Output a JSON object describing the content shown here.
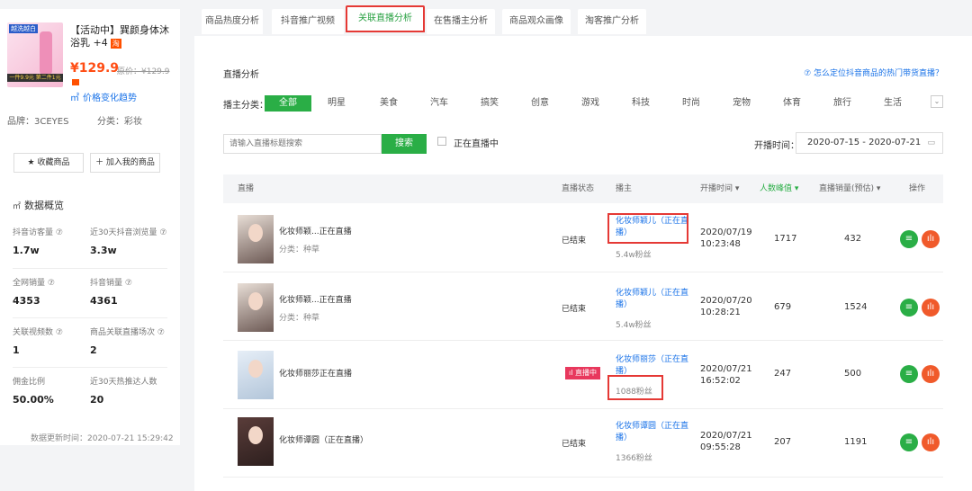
{
  "product": {
    "image_tag": "越洗越白",
    "image_bar": "一件9.9元 第二件1元",
    "title": "【活动中】巽颜身体沐浴乳 +4",
    "tb_badge": "淘",
    "price": "¥129.9",
    "original_price": "原价：¥129.9",
    "trend_link": "价格变化趋势",
    "brand": "品牌：3CEYES",
    "category": "分类：彩妆",
    "fav_button": "★ 收藏商品",
    "add_button": "＋ 加入我的商品"
  },
  "overview": {
    "title": "数据概览",
    "stats": [
      {
        "label": "抖音访客量 ⑦",
        "value": "1.7w"
      },
      {
        "label": "近30天抖音浏览量 ⑦",
        "value": "3.3w"
      },
      {
        "label": "全网销量 ⑦",
        "value": "4353"
      },
      {
        "label": "抖音销量 ⑦",
        "value": "4361"
      },
      {
        "label": "关联视频数 ⑦",
        "value": "1"
      },
      {
        "label": "商品关联直播场次 ⑦",
        "value": "2"
      },
      {
        "label": "佣金比例",
        "value": "50.00%"
      },
      {
        "label": "近30天热推达人数",
        "value": "20"
      }
    ],
    "updated": "数据更新时间：2020-07-21 15:29:42"
  },
  "tabs": [
    "商品热度分析",
    "抖音推广视频",
    "关联直播分析",
    "在售播主分析",
    "商品观众画像",
    "淘客推广分析"
  ],
  "active_tab": 2,
  "section": {
    "title": "直播分析",
    "help": "⑦ 怎么定位抖音商品的热门带货直播？"
  },
  "categories": {
    "label": "播主分类：",
    "items": [
      "全部",
      "明星",
      "美食",
      "汽车",
      "搞笑",
      "创意",
      "游戏",
      "科技",
      "时尚",
      "宠物",
      "体育",
      "旅行",
      "生活"
    ]
  },
  "search": {
    "placeholder": "请输入直播标题搜索",
    "button": "搜索",
    "live_only": "正在直播中",
    "date_label": "开播时间：",
    "date_range": "2020-07-15 - 2020-07-21"
  },
  "table": {
    "headers": [
      "直播",
      "直播状态",
      "播主",
      "开播时间 ▾",
      "人数峰值 ▾",
      "直播销量(预估) ▾",
      "操作"
    ],
    "rows": [
      {
        "title": "化妆师颖...正在直播",
        "category": "分类：种草",
        "status": "已结束",
        "live": false,
        "host": "化妆师颖儿（正在直播）",
        "fans": "5.4w粉丝",
        "time": "2020/07/19 10:23:48",
        "peak": "1717",
        "sales": "432"
      },
      {
        "title": "化妆师颖...正在直播",
        "category": "分类：种草",
        "status": "已结束",
        "live": false,
        "host": "化妆师颖儿（正在直播）",
        "fans": "5.4w粉丝",
        "time": "2020/07/20 10:28:21",
        "peak": "679",
        "sales": "1524"
      },
      {
        "title": "化妆师丽莎正在直播",
        "category": "",
        "status": "直播中",
        "live": true,
        "host": "化妆师丽莎（正在直播）",
        "fans": "1088粉丝",
        "time": "2020/07/21 16:52:02",
        "peak": "247",
        "sales": "500"
      },
      {
        "title": "化妆师谭圆（正在直播）",
        "category": "",
        "status": "已结束",
        "live": false,
        "host": "化妆师谭圆（正在直播）",
        "fans": "1366粉丝",
        "time": "2020/07/21 09:55:28",
        "peak": "207",
        "sales": "1191"
      }
    ]
  },
  "icons": {
    "detail": "list-icon",
    "chart": "bar-chart-icon"
  },
  "colors": {
    "accent_green": "#2aae46",
    "link_blue": "#1a73e8",
    "price_red": "#ff4d14",
    "highlight_red": "#e53935"
  }
}
